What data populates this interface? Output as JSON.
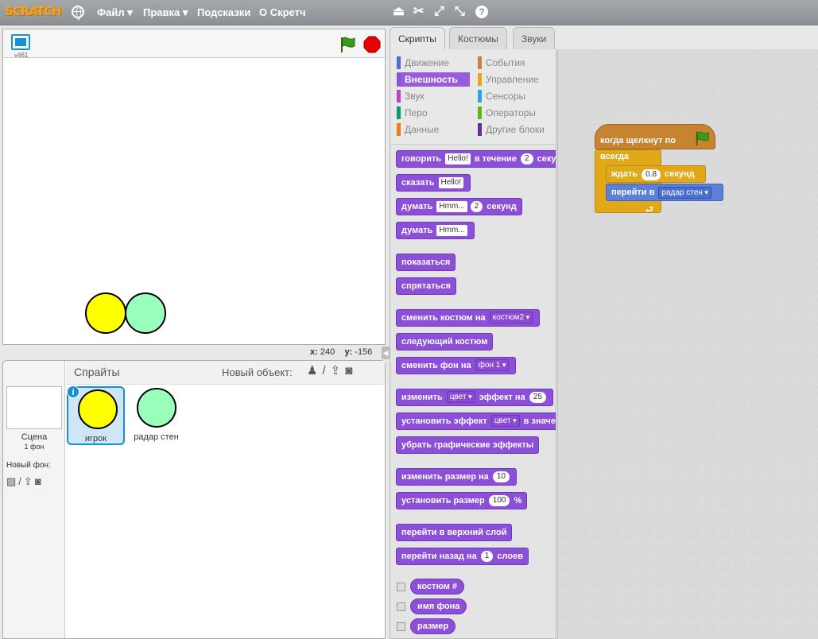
{
  "topbar": {
    "logo": "SCRATCH",
    "menus": [
      "Файл ▾",
      "Правка ▾",
      "Подсказки",
      "О Скретч"
    ],
    "icons": [
      "duplicate-icon",
      "delete-icon",
      "grow-icon",
      "shrink-icon",
      "help-icon"
    ]
  },
  "stage": {
    "version": "v461",
    "coords": {
      "x_label": "x:",
      "x_value": "240",
      "y_label": "y:",
      "y_value": "-156"
    },
    "sprites": [
      {
        "name": "игрок",
        "color": "#ffff00"
      },
      {
        "name": "радар стен",
        "color": "#99ffbb"
      }
    ]
  },
  "sprites_panel": {
    "title": "Спрайты",
    "new_object_label": "Новый объект:",
    "scene_label": "Сцена",
    "scene_bg_count": "1 фон",
    "new_backdrop_label": "Новый фон:",
    "sprite_list": [
      {
        "label": "игрок",
        "selected": true,
        "color": "#ffff00"
      },
      {
        "label": "радар стен",
        "selected": false,
        "color": "#99ffbb"
      }
    ]
  },
  "tabs": [
    "Скрипты",
    "Костюмы",
    "Звуки"
  ],
  "categories": {
    "left": [
      {
        "label": "Движение",
        "color": "#4a6cd4"
      },
      {
        "label": "Внешность",
        "color": "#8a55d7",
        "active": true
      },
      {
        "label": "Звук",
        "color": "#bb42c3"
      },
      {
        "label": "Перо",
        "color": "#0e9a6c"
      },
      {
        "label": "Данные",
        "color": "#ee7d16"
      }
    ],
    "right": [
      {
        "label": "События",
        "color": "#c88330"
      },
      {
        "label": "Управление",
        "color": "#e1a91a"
      },
      {
        "label": "Сенсоры",
        "color": "#2ca5e2"
      },
      {
        "label": "Операторы",
        "color": "#5cb712"
      },
      {
        "label": "Другие блоки",
        "color": "#632d99"
      }
    ]
  },
  "blocks": {
    "say_for": {
      "t1": "говорить",
      "v1": "Hello!",
      "t2": "в течение",
      "v2": "2",
      "t3": "секунд"
    },
    "say": {
      "t1": "сказать",
      "v1": "Hello!"
    },
    "think_for": {
      "t1": "думать",
      "v1": "Hmm...",
      "v2": "2",
      "t2": "секунд"
    },
    "think": {
      "t1": "думать",
      "v1": "Hmm..."
    },
    "show": "показаться",
    "hide": "спрятаться",
    "switch_costume": {
      "t1": "сменить костюм на",
      "v1": "костюм2"
    },
    "next_costume": "следующий костюм",
    "switch_backdrop": {
      "t1": "сменить фон на",
      "v1": "фон 1"
    },
    "change_effect": {
      "t1": "изменить",
      "v1": "цвет",
      "t2": "эффект на",
      "v2": "25"
    },
    "set_effect": {
      "t1": "установить эффект",
      "v1": "цвет",
      "t2": "в значение"
    },
    "clear_effects": "убрать графические эффекты",
    "change_size": {
      "t1": "изменить размер на",
      "v1": "10"
    },
    "set_size": {
      "t1": "установить размер",
      "v1": "100",
      "t2": "%"
    },
    "front": "перейти в верхний слой",
    "back": {
      "t1": "перейти назад на",
      "v1": "1",
      "t2": "слоев"
    },
    "reporters": [
      "костюм #",
      "имя фона",
      "размер"
    ]
  },
  "script": {
    "hat": "когда щелкнут по",
    "forever": "всегда",
    "wait": {
      "t1": "ждать",
      "v1": "0.8",
      "t2": "секунд"
    },
    "goto": {
      "t1": "перейти в",
      "v1": "радар стен"
    },
    "loop_arrow": "⮐"
  },
  "colors": {
    "looks": "#8c4fd9",
    "events": "#c88330",
    "control": "#e1a91a",
    "motion": "#5c80d9",
    "stop": "#e60000",
    "flag": "#2f8a16"
  }
}
